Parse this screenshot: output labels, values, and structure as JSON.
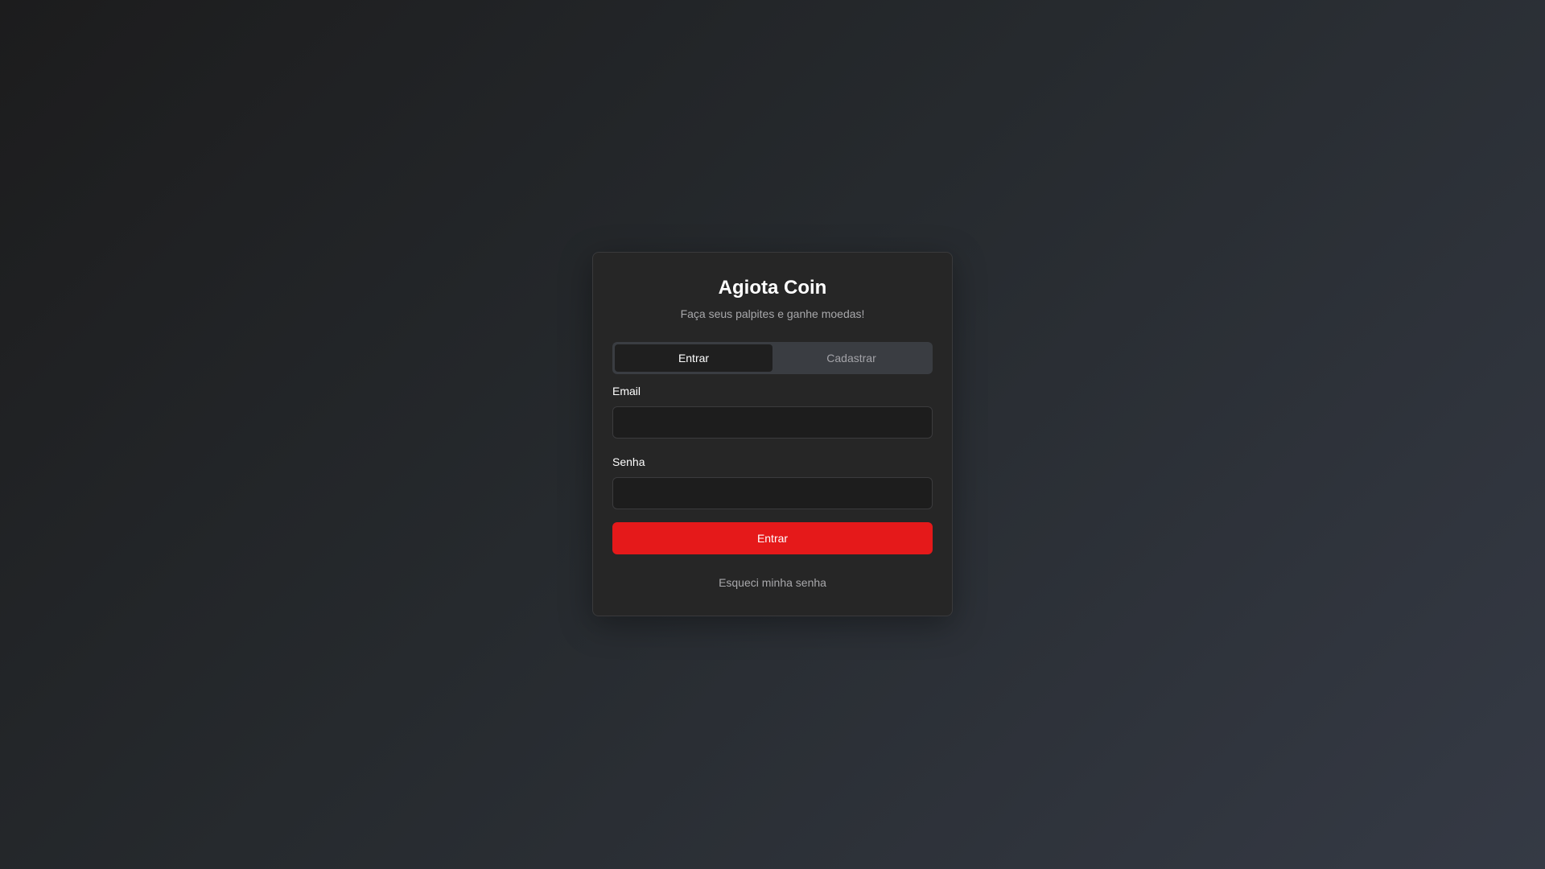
{
  "app": {
    "title": "Agiota Coin",
    "subtitle": "Faça seus palpites e ganhe moedas!"
  },
  "tabs": [
    {
      "label": "Entrar",
      "active": true
    },
    {
      "label": "Cadastrar",
      "active": false
    }
  ],
  "form": {
    "email_label": "Email",
    "email_value": "",
    "email_placeholder": "",
    "password_label": "Senha",
    "password_value": "",
    "password_placeholder": "",
    "submit_label": "Entrar",
    "forgot_label": "Esqueci minha senha"
  },
  "colors": {
    "accent": "#e5191a",
    "card_background": "#262626",
    "page_background_start": "#1c1c1d",
    "page_background_end": "#353a45"
  }
}
